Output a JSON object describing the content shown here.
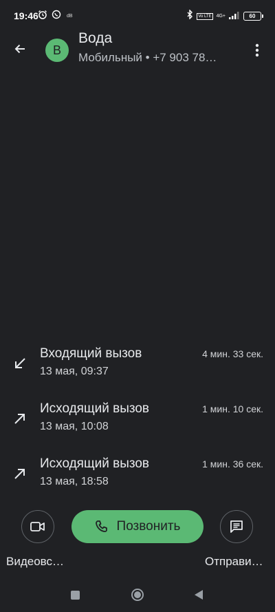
{
  "status_bar": {
    "time": "19:46",
    "signal_text": "dB",
    "network_type": "4G+",
    "lte_label": "Vo LTE",
    "battery": "60",
    "icons": [
      "alarm-icon",
      "viber-icon",
      "bluetooth-icon",
      "signal-icon",
      "battery-icon"
    ]
  },
  "header": {
    "avatar_letter": "В",
    "contact_name": "Вода",
    "contact_sub": "Мобильный • +7 903 78…",
    "avatar_color": "#5bb974"
  },
  "call_log": [
    {
      "type": "Входящий вызов",
      "date": "13 мая, 09:37",
      "duration": "4 мин. 33 сек.",
      "direction": "incoming"
    },
    {
      "type": "Исходящий вызов",
      "date": "13 мая, 10:08",
      "duration": "1 мин. 10 сек.",
      "direction": "outgoing"
    },
    {
      "type": "Исходящий вызов",
      "date": "13 мая, 18:58",
      "duration": "1 мин. 36 сек.",
      "direction": "outgoing"
    }
  ],
  "actions": {
    "video_label": "Видеовс…",
    "call_label": "Позвонить",
    "message_label": "Отправи…"
  },
  "colors": {
    "background": "#202124",
    "accent_green": "#5bb974",
    "text_primary": "#e8eaed",
    "text_secondary": "#bdc1c6"
  }
}
